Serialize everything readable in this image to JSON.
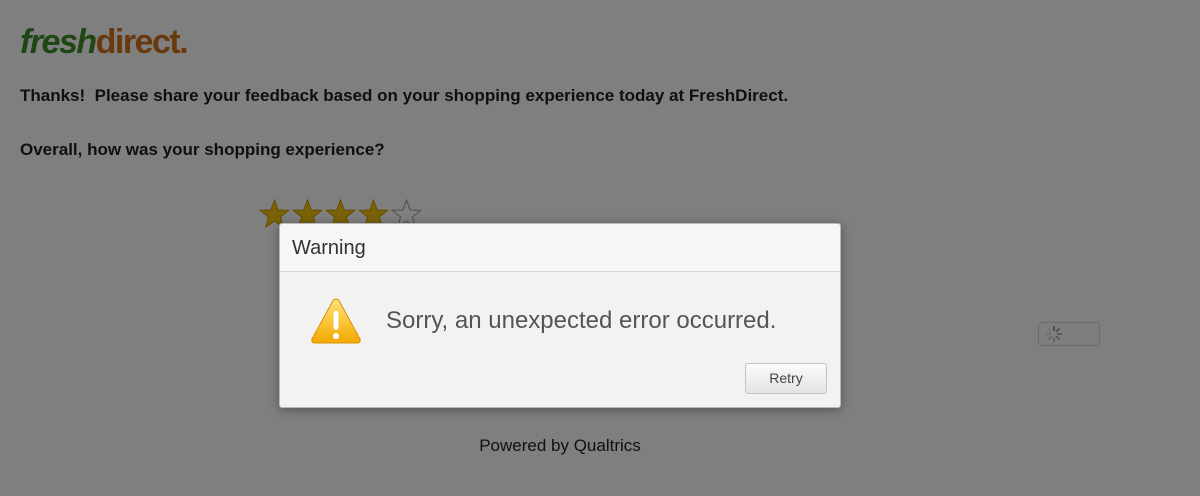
{
  "brand": {
    "logo_fresh": "fresh",
    "logo_direct": "direct",
    "logo_dot": ".",
    "colors": {
      "fresh": "#3f8f2d",
      "direct": "#d3731c"
    }
  },
  "survey": {
    "intro_text": "Thanks!  Please share your feedback based on your shopping experience today at FreshDirect.",
    "question_text": "Overall, how was your shopping experience?",
    "rating": {
      "selected": 4,
      "max": 5,
      "filled_color": "#f2c40f"
    }
  },
  "loader": {
    "icon": "spinner-icon"
  },
  "footer": {
    "powered_by": "Powered by Qualtrics"
  },
  "dialog": {
    "title": "Warning",
    "icon": "warning-icon",
    "message": "Sorry, an unexpected error occurred.",
    "retry_label": "Retry"
  }
}
